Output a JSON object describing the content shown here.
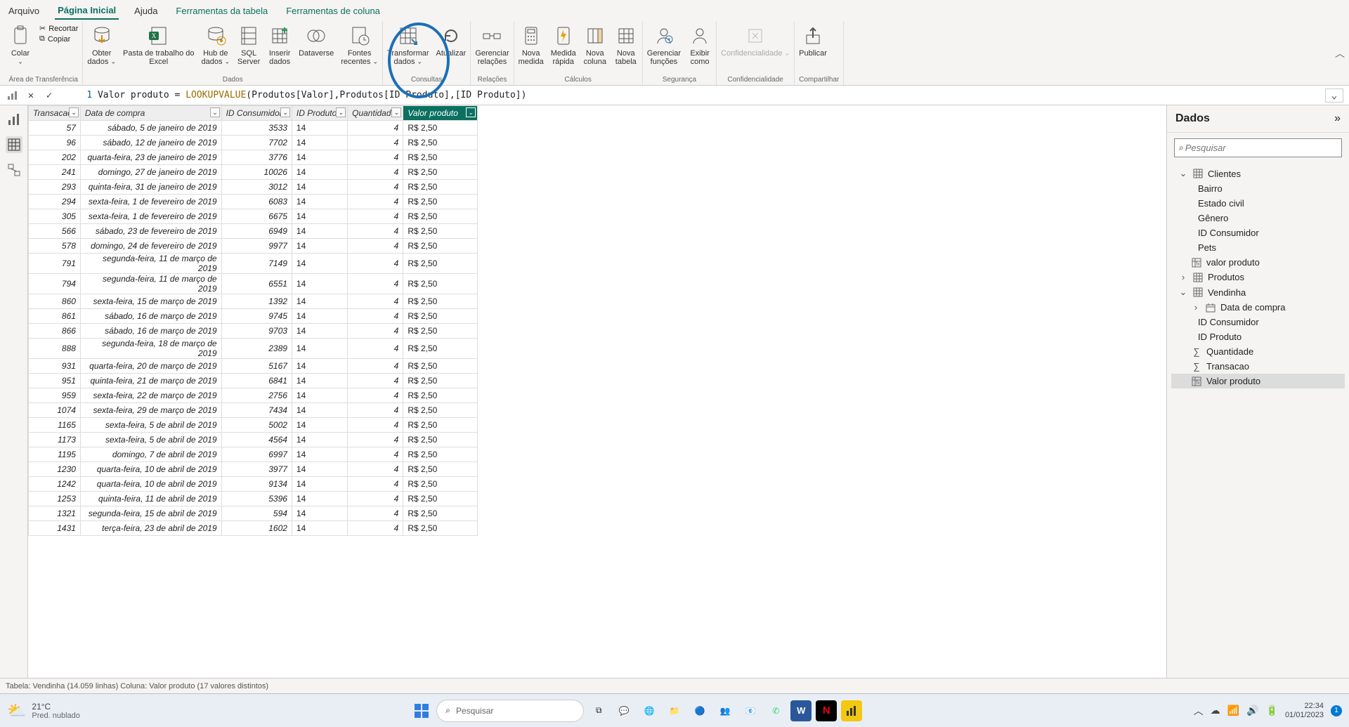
{
  "menubar": [
    "Arquivo",
    "Página Inicial",
    "Ajuda",
    "Ferramentas da tabela",
    "Ferramentas de coluna"
  ],
  "menubar_active_index": 1,
  "ribbon": {
    "groups": [
      {
        "label": "Área de Transferência",
        "buttons": [
          {
            "t": "Colar",
            "d": "chev",
            "icon": "clipboard"
          }
        ],
        "extra": [
          {
            "t": "Recortar",
            "i": "✂"
          },
          {
            "t": "Copiar",
            "i": "⧉"
          }
        ]
      },
      {
        "label": "Dados",
        "buttons": [
          {
            "t": "Obter\ndados",
            "d": "chev",
            "icon": "db-down"
          },
          {
            "t": "Pasta de trabalho do\nExcel",
            "icon": "excel"
          },
          {
            "t": "Hub de\ndados",
            "d": "chev",
            "icon": "hub"
          },
          {
            "t": "SQL\nServer",
            "icon": "sql"
          },
          {
            "t": "Inserir\ndados",
            "icon": "insert"
          },
          {
            "t": "Dataverse",
            "icon": "dataverse"
          },
          {
            "t": "Fontes\nrecentes",
            "d": "chev",
            "icon": "recent"
          }
        ]
      },
      {
        "label": "Consultas",
        "buttons": [
          {
            "t": "Transformar\ndados",
            "d": "chev",
            "icon": "transform"
          },
          {
            "t": "Atualizar",
            "icon": "refresh"
          }
        ]
      },
      {
        "label": "Relações",
        "buttons": [
          {
            "t": "Gerenciar\nrelações",
            "icon": "rel"
          }
        ]
      },
      {
        "label": "Cálculos",
        "buttons": [
          {
            "t": "Nova\nmedida",
            "icon": "calc"
          },
          {
            "t": "Medida\nrápida",
            "icon": "quick"
          },
          {
            "t": "Nova\ncoluna",
            "icon": "col"
          },
          {
            "t": "Nova\ntabela",
            "icon": "tab"
          }
        ]
      },
      {
        "label": "Segurança",
        "buttons": [
          {
            "t": "Gerenciar\nfunções",
            "icon": "roles"
          },
          {
            "t": "Exibir\ncomo",
            "icon": "view"
          }
        ]
      },
      {
        "label": "Confidencialidade",
        "buttons": [
          {
            "t": "Confidencialidade",
            "d": "chev",
            "disabled": true,
            "icon": "conf"
          }
        ]
      },
      {
        "label": "Compartilhar",
        "buttons": [
          {
            "t": "Publicar",
            "icon": "publish"
          }
        ]
      }
    ]
  },
  "formula": {
    "line": "1",
    "prefix": " Valor produto = ",
    "fn": "LOOKUPVALUE",
    "rest": "(Produtos[Valor],Produtos[ID Produto],[ID Produto])"
  },
  "columns": [
    "Transacao",
    "Data de compra",
    "ID Consumidor",
    "ID Produto",
    "Quantidade",
    "Valor produto"
  ],
  "selected_col_index": 5,
  "rows": [
    [
      57,
      "sábado, 5 de janeiro de 2019",
      3533,
      "14",
      4,
      "R$ 2,50"
    ],
    [
      96,
      "sábado, 12 de janeiro de 2019",
      7702,
      "14",
      4,
      "R$ 2,50"
    ],
    [
      202,
      "quarta-feira, 23 de janeiro de 2019",
      3776,
      "14",
      4,
      "R$ 2,50"
    ],
    [
      241,
      "domingo, 27 de janeiro de 2019",
      10026,
      "14",
      4,
      "R$ 2,50"
    ],
    [
      293,
      "quinta-feira, 31 de janeiro de 2019",
      3012,
      "14",
      4,
      "R$ 2,50"
    ],
    [
      294,
      "sexta-feira, 1 de fevereiro de 2019",
      6083,
      "14",
      4,
      "R$ 2,50"
    ],
    [
      305,
      "sexta-feira, 1 de fevereiro de 2019",
      6675,
      "14",
      4,
      "R$ 2,50"
    ],
    [
      566,
      "sábado, 23 de fevereiro de 2019",
      6949,
      "14",
      4,
      "R$ 2,50"
    ],
    [
      578,
      "domingo, 24 de fevereiro de 2019",
      9977,
      "14",
      4,
      "R$ 2,50"
    ],
    [
      791,
      "segunda-feira, 11 de março de 2019",
      7149,
      "14",
      4,
      "R$ 2,50"
    ],
    [
      794,
      "segunda-feira, 11 de março de 2019",
      6551,
      "14",
      4,
      "R$ 2,50"
    ],
    [
      860,
      "sexta-feira, 15 de março de 2019",
      1392,
      "14",
      4,
      "R$ 2,50"
    ],
    [
      861,
      "sábado, 16 de março de 2019",
      9745,
      "14",
      4,
      "R$ 2,50"
    ],
    [
      866,
      "sábado, 16 de março de 2019",
      9703,
      "14",
      4,
      "R$ 2,50"
    ],
    [
      888,
      "segunda-feira, 18 de março de 2019",
      2389,
      "14",
      4,
      "R$ 2,50"
    ],
    [
      931,
      "quarta-feira, 20 de março de 2019",
      5167,
      "14",
      4,
      "R$ 2,50"
    ],
    [
      951,
      "quinta-feira, 21 de março de 2019",
      6841,
      "14",
      4,
      "R$ 2,50"
    ],
    [
      959,
      "sexta-feira, 22 de março de 2019",
      2756,
      "14",
      4,
      "R$ 2,50"
    ],
    [
      1074,
      "sexta-feira, 29 de março de 2019",
      7434,
      "14",
      4,
      "R$ 2,50"
    ],
    [
      1165,
      "sexta-feira, 5 de abril de 2019",
      5002,
      "14",
      4,
      "R$ 2,50"
    ],
    [
      1173,
      "sexta-feira, 5 de abril de 2019",
      4564,
      "14",
      4,
      "R$ 2,50"
    ],
    [
      1195,
      "domingo, 7 de abril de 2019",
      6997,
      "14",
      4,
      "R$ 2,50"
    ],
    [
      1230,
      "quarta-feira, 10 de abril de 2019",
      3977,
      "14",
      4,
      "R$ 2,50"
    ],
    [
      1242,
      "quarta-feira, 10 de abril de 2019",
      9134,
      "14",
      4,
      "R$ 2,50"
    ],
    [
      1253,
      "quinta-feira, 11 de abril de 2019",
      5396,
      "14",
      4,
      "R$ 2,50"
    ],
    [
      1321,
      "segunda-feira, 15 de abril de 2019",
      594,
      "14",
      4,
      "R$ 2,50"
    ],
    [
      1431,
      "terça-feira, 23 de abril de 2019",
      1602,
      "14",
      4,
      "R$ 2,50"
    ]
  ],
  "right_panel": {
    "title": "Dados",
    "search_placeholder": "Pesquisar",
    "tree": [
      {
        "lvl": 1,
        "exp": "open",
        "icon": "table",
        "label": "Clientes"
      },
      {
        "lvl": 2,
        "icon": "",
        "label": "Bairro"
      },
      {
        "lvl": 2,
        "icon": "",
        "label": "Estado civil"
      },
      {
        "lvl": 2,
        "icon": "",
        "label": "Gênero"
      },
      {
        "lvl": 2,
        "icon": "",
        "label": "ID Consumidor"
      },
      {
        "lvl": 2,
        "icon": "",
        "label": "Pets"
      },
      {
        "lvl": 2,
        "pad": "lev2b",
        "icon": "fx",
        "label": "valor produto"
      },
      {
        "lvl": 1,
        "exp": "closed",
        "icon": "table",
        "label": "Produtos"
      },
      {
        "lvl": 1,
        "exp": "open",
        "icon": "table",
        "label": "Vendinha"
      },
      {
        "lvl": 2,
        "pad": "lev2b",
        "exp": "closed",
        "icon": "cal",
        "label": "Data de compra"
      },
      {
        "lvl": 2,
        "icon": "",
        "label": "ID Consumidor"
      },
      {
        "lvl": 2,
        "icon": "",
        "label": "ID Produto"
      },
      {
        "lvl": 2,
        "pad": "lev2b",
        "icon": "sum",
        "label": "Quantidade"
      },
      {
        "lvl": 2,
        "pad": "lev2b",
        "icon": "sum",
        "label": "Transacao"
      },
      {
        "lvl": 2,
        "pad": "lev2b",
        "icon": "fx",
        "label": "Valor produto",
        "sel": true
      }
    ]
  },
  "status": "Tabela: Vendinha (14.059 linhas) Coluna: Valor produto (17 valores distintos)",
  "taskbar": {
    "temp": "21°C",
    "weather": "Pred. nublado",
    "search_placeholder": "Pesquisar",
    "time": "22:34",
    "date": "01/01/2023"
  }
}
